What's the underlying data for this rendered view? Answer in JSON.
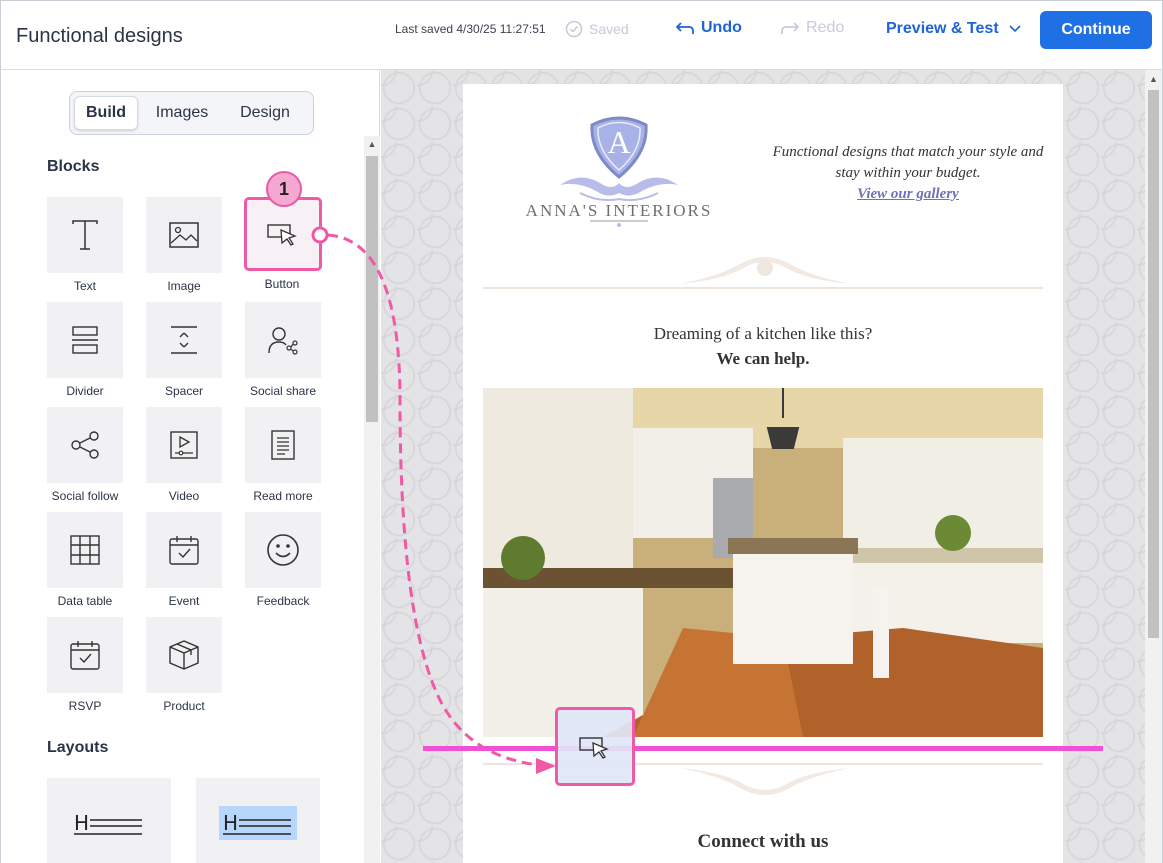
{
  "header": {
    "title": "Functional designs",
    "last_saved": "Last saved 4/30/25 11:27:51",
    "saved": "Saved",
    "undo": "Undo",
    "redo": "Redo",
    "preview": "Preview & Test",
    "continue": "Continue"
  },
  "sidebar": {
    "tabs": [
      "Build",
      "Images",
      "Design"
    ],
    "blocks_heading": "Blocks",
    "blocks": [
      "Text",
      "Image",
      "Button",
      "Divider",
      "Spacer",
      "Social share",
      "Social follow",
      "Video",
      "Read more",
      "Data table",
      "Event",
      "Feedback",
      "RSVP",
      "Product"
    ],
    "layouts_heading": "Layouts"
  },
  "email": {
    "brand_initial": "A",
    "brand_name": "ANNA'S INTERIORS",
    "tagline": "Functional designs that match your style and stay within your budget.",
    "gallery_link": "View our gallery",
    "dream_line1": "Dreaming of a kitchen like this?",
    "dream_line2": "We can help.",
    "connect": "Connect with us"
  },
  "annotation": {
    "step": "1"
  },
  "colors": {
    "accent": "#1f6fe5",
    "highlight": "#ef5aa6",
    "drop_line": "#f050d2"
  }
}
